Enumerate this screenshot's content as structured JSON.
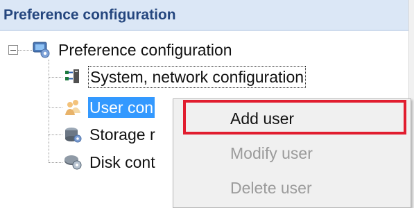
{
  "header": {
    "title": "Preference configuration"
  },
  "tree": {
    "root": {
      "label": "Preference configuration",
      "icon": "gear-settings-icon"
    },
    "children": [
      {
        "label": "System, network configuration",
        "icon": "network-icon"
      },
      {
        "label": "User con",
        "icon": "users-icon"
      },
      {
        "label": "Storage r",
        "icon": "storage-icon"
      },
      {
        "label": "Disk cont",
        "icon": "disk-icon"
      }
    ]
  },
  "context_menu": {
    "items": [
      {
        "label": "Add user",
        "enabled": true
      },
      {
        "label": "Modify user",
        "enabled": false
      },
      {
        "label": "Delete user",
        "enabled": false
      }
    ]
  },
  "colors": {
    "selection": "#3399ff",
    "highlight": "#e11d2f",
    "header_bg": "#dbe7f6",
    "header_text": "#24467e"
  }
}
